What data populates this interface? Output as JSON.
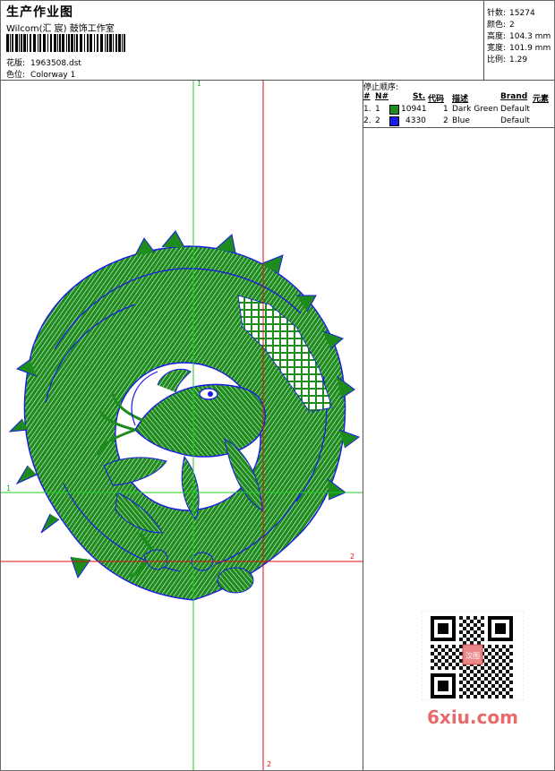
{
  "header": {
    "title": "生产作业图",
    "studio": "Wilcom(汇 宸) 鼓饰工作室",
    "design_label": "花版:",
    "design_value": "1963508.dst",
    "colorway_label": "色位:",
    "colorway_value": "Colorway 1"
  },
  "stats": {
    "stitches_label": "针数:",
    "stitches_value": "15274",
    "colors_label": "颜色:",
    "colors_value": "2",
    "height_label": "高度:",
    "height_value": "104.3 mm",
    "width_label": "宽度:",
    "width_value": "101.9 mm",
    "ratio_label": "比例:",
    "ratio_value": "1.29"
  },
  "sequence": {
    "title": "停止顺序:",
    "headers": {
      "num": "#",
      "n": "N#",
      "st": "St.",
      "code": "代码",
      "desc": "描述",
      "brand": "Brand",
      "element": "元素"
    },
    "rows": [
      {
        "num": "1.",
        "n": "1",
        "color": "#1d8c1d",
        "st": "10941",
        "code": "1",
        "desc": "Dark Green",
        "brand": "Default"
      },
      {
        "num": "2.",
        "n": "2",
        "color": "#1a1ae8",
        "st": "4330",
        "code": "2",
        "desc": "Blue",
        "brand": "Default"
      }
    ]
  },
  "axes": {
    "green_vertical": "1",
    "green_horizontal": "1",
    "red_horizontal": "2",
    "red_vertical": "2"
  },
  "watermark": {
    "text": "6xiu.com",
    "stamp": "汉图"
  },
  "colors": {
    "green_thread": "#1d8c1d",
    "blue_thread": "#1a1ae8",
    "green_guide": "#22cc22",
    "red_guide": "#dd1111"
  }
}
